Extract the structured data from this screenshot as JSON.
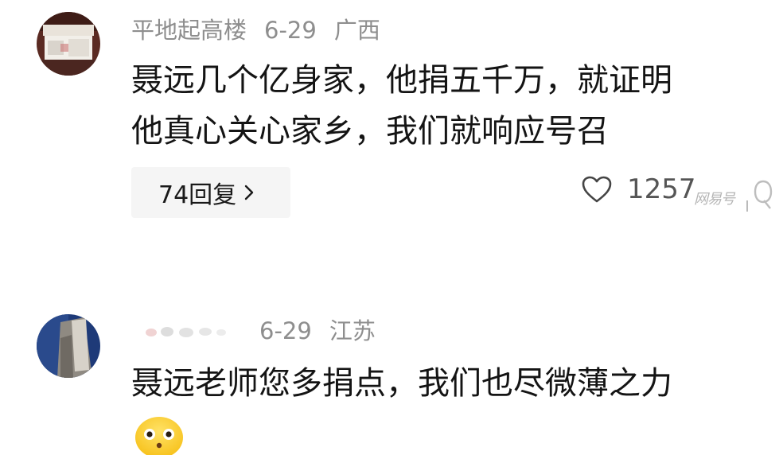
{
  "comments": [
    {
      "username": "平地起高楼",
      "date": "6-29",
      "location": "广西",
      "text": "聂远几个亿身家，他捐五千万，就证明\n他真心关心家乡，我们就响应号召",
      "reply_label": "74回复",
      "like_count": "1257"
    },
    {
      "username": "",
      "date": "6-29",
      "location": "江苏",
      "text": "聂远老师您多捐点，我们也尽微薄之力"
    }
  ],
  "watermark": "网易号",
  "icons": {
    "reply_chevron": "chevron-right-icon",
    "like": "heart-outline-icon",
    "emoji": "smiley-emoji-icon"
  },
  "colors": {
    "meta_text": "#8e8e8e",
    "body_text": "#141414",
    "pill_bg": "#f5f5f5"
  }
}
